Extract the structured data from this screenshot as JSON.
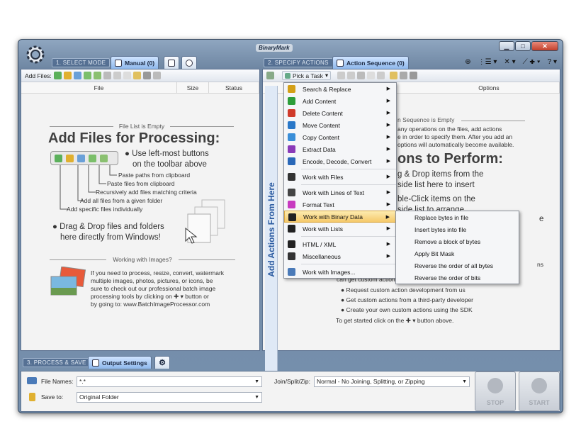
{
  "app": {
    "logo": "BinaryMark"
  },
  "window_buttons": {
    "minimize": "▁",
    "maximize": "□",
    "close": "✕"
  },
  "modes": {
    "select": "1. SELECT MODE",
    "specify": "2. SPECIFY ACTIONS",
    "process": "3. PROCESS & SAVE"
  },
  "tabs": {
    "manual": "Manual (0)",
    "action_sequence": "Action Sequence (0)",
    "output_settings": "Output Settings"
  },
  "top_tools": {
    "t1": "⊕",
    "t2": "⋮☰ ▾",
    "t3": "✕ ▾",
    "t4": "⟋ ✚ ▾",
    "t5": "? ▾"
  },
  "left": {
    "toolbar_label": "Add Files:",
    "columns": [
      "File",
      "Size",
      "Status"
    ],
    "empty_title": "File List is Empty",
    "headline": "Add Files for Processing:",
    "use_buttons": "● Use left-most buttons",
    "use_buttons_2": "on the toolbar above",
    "callouts": [
      "Paste paths from clipboard",
      "Paste files from clipboard",
      "Recursively add files matching criteria",
      "Add all files from a given folder",
      "Add specific files individually"
    ],
    "drag_1": "● Drag & Drop files and folders",
    "drag_2": "here directly from Windows!",
    "images_title": "Working with Images?",
    "images_text": [
      "If you need to process, resize, convert, watermark",
      "multiple images, photos, pictures, or icons, be",
      "sure to check out our professional batch image",
      "processing tools by clicking on  ✚ ▾  button or",
      "by going to: www.BatchImageProcessor.com"
    ]
  },
  "right": {
    "pick_task": "Pick a Task",
    "options_col": "Options",
    "vbar": "Add Actions From Here",
    "empty_title": "n Sequence is Empty",
    "lines_a": [
      "any operations on the files, add actions",
      "e in order to specify them. After you add an",
      "options will automatically become available."
    ],
    "headline": "ons to Perform:",
    "lines_b": [
      "g & Drop items from the",
      "side list here to insert"
    ],
    "lines_c": [
      "ble-Click items on the",
      "side list to arrange"
    ],
    "custom_fragment": "can get custom actions",
    "bullets": [
      "● Request custom action development from us",
      "● Get custom actions from a third-party developer",
      "● Create your own custom actions using the SDK"
    ],
    "started": "To get started click on the  ✚ ▾  button above.",
    "edge_ns": "ns",
    "edge_e": "e"
  },
  "menu": {
    "items": [
      {
        "label": "Search & Replace",
        "icon": "search-replace-icon",
        "color": "#d4a017",
        "sub": true
      },
      {
        "label": "Add Content",
        "icon": "add-content-icon",
        "color": "#2e9e3a",
        "sub": true
      },
      {
        "label": "Delete Content",
        "icon": "delete-content-icon",
        "color": "#d03a2a",
        "sub": true
      },
      {
        "label": "Move Content",
        "icon": "move-content-icon",
        "color": "#2a78c8",
        "sub": true
      },
      {
        "label": "Copy Content",
        "icon": "copy-content-icon",
        "color": "#3a8ed8",
        "sub": true
      },
      {
        "label": "Extract Data",
        "icon": "extract-data-icon",
        "color": "#8a3ab8",
        "sub": true
      },
      {
        "label": "Encode, Decode, Convert",
        "icon": "encode-icon",
        "color": "#2a68b8",
        "sub": true
      },
      {
        "label": "Work with Files",
        "icon": "files-icon",
        "color": "#333333",
        "sub": true
      },
      {
        "label": "Work with Lines of Text",
        "icon": "lines-icon",
        "color": "#444444",
        "sub": true
      },
      {
        "label": "Format Text",
        "icon": "format-text-icon",
        "color": "#c83ac0",
        "sub": true
      },
      {
        "label": "Work with Binary Data",
        "icon": "binary-data-icon",
        "color": "#222222",
        "sub": true
      },
      {
        "label": "Work with Lists",
        "icon": "lists-icon",
        "color": "#222222",
        "sub": true
      },
      {
        "label": "HTML / XML",
        "icon": "html-xml-icon",
        "color": "#222222",
        "sub": true
      },
      {
        "label": "Miscellaneous",
        "icon": "misc-icon",
        "color": "#333333",
        "sub": true
      },
      {
        "label": "Work with Images...",
        "icon": "images-icon",
        "color": "#4a7ab8",
        "sub": false
      }
    ],
    "submenu": [
      "Replace bytes in file",
      "Insert bytes into file",
      "Remove a block of bytes",
      "Apply Bit Mask",
      "Reverse the order of all bytes",
      "Reverse the order of bits"
    ]
  },
  "bottom": {
    "file_names_label": "File Names:",
    "file_names_value": "*.*",
    "save_to_label": "Save to:",
    "save_to_value": "Original Folder",
    "join_label": "Join/Split/Zip:",
    "join_value": "Normal - No Joining, Splitting, or Zipping",
    "stop": "STOP",
    "start": "START"
  }
}
